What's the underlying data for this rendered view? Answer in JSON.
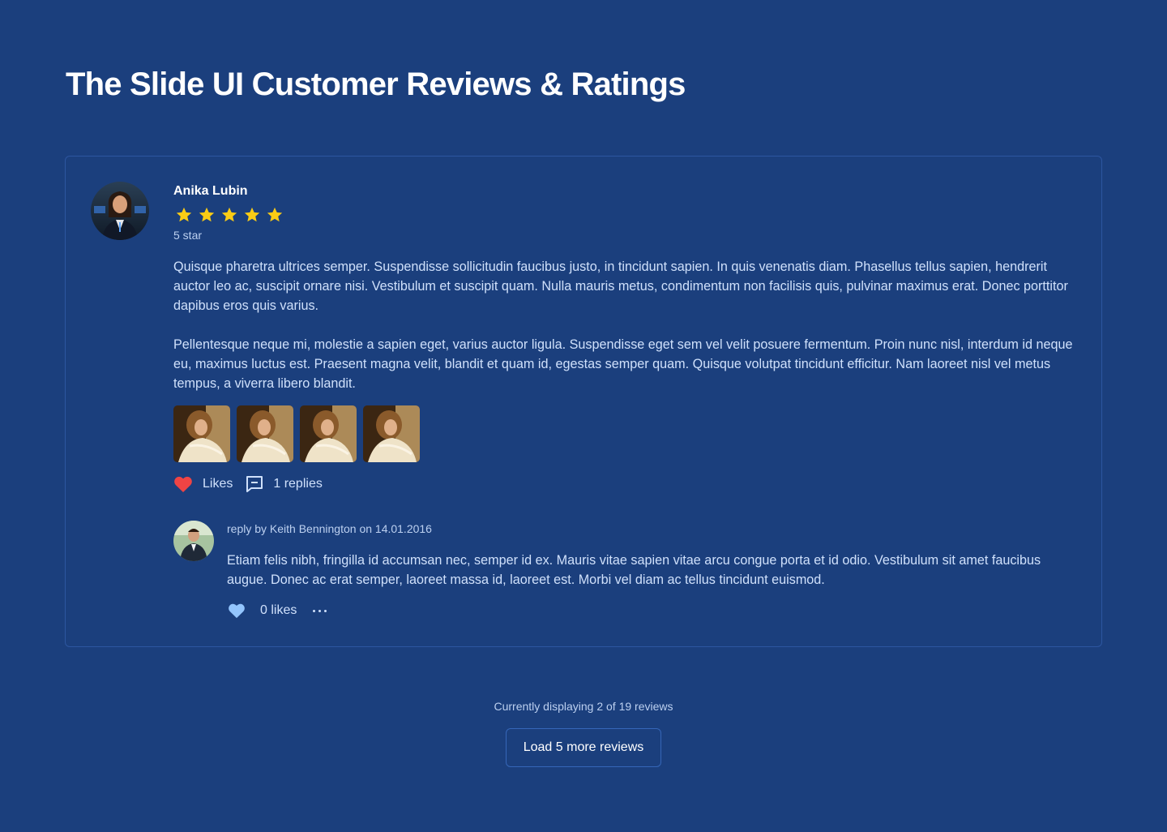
{
  "page": {
    "title": "The Slide UI Customer Reviews & Ratings"
  },
  "review": {
    "author": "Anika Lubin",
    "rating": 5,
    "rating_max": 5,
    "rating_label": "5 star",
    "paragraphs": [
      "Quisque pharetra ultrices semper. Suspendisse sollicitudin faucibus justo, in tincidunt sapien. In quis venenatis diam. Phasellus tellus sapien, hendrerit auctor leo ac, suscipit ornare nisi. Vestibulum et suscipit quam. Nulla mauris metus, condimentum non facilisis quis, pulvinar maximus erat. Donec porttitor dapibus eros quis varius.",
      "Pellentesque neque mi, molestie a sapien eget, varius auctor ligula. Suspendisse eget sem vel velit posuere fermentum. Proin nunc nisl, interdum id neque eu, maximus luctus est. Praesent magna velit, blandit et quam id, egestas semper quam. Quisque volutpat tincidunt efficitur. Nam laoreet nisl vel metus tempus, a viverra libero blandit."
    ],
    "photo_count": 4,
    "likes_label": "Likes",
    "replies_label": "1 replies",
    "like_icon": "heart-icon",
    "reply_icon": "comment-icon",
    "like_color": "#ef4444"
  },
  "reply": {
    "meta": "reply by Keith Bennington on 14.01.2016",
    "body": "Etiam felis nibh, fringilla id accumsan nec, semper id ex. Mauris vitae sapien vitae arcu congue porta et id odio. Vestibulum sit amet faucibus augue. Donec ac erat semper, laoreet massa id, laoreet est. Morbi vel diam ac tellus tincidunt euismod.",
    "likes_label": "0 likes",
    "like_color": "#93c5fd",
    "more_icon": "more-horizontal-icon"
  },
  "footer": {
    "status": "Currently displaying 2 of 19 reviews",
    "load_more_label": "Load 5 more reviews"
  },
  "colors": {
    "background": "#1b3f7d",
    "star": "#facc15",
    "card_border": "#2d56a0"
  }
}
